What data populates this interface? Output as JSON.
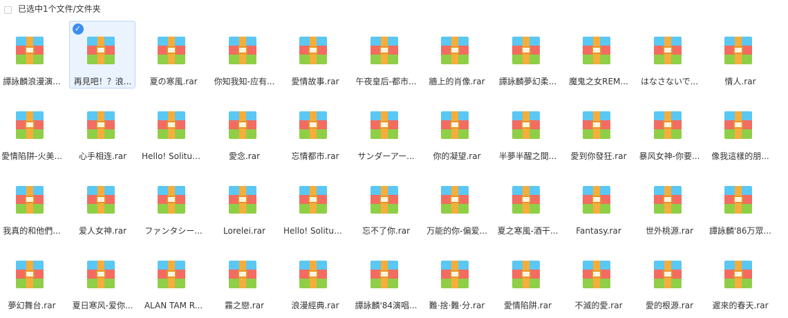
{
  "header": {
    "selection_text": "已选中1个文件/文件夹"
  },
  "colors": {
    "accent": "#3b8df2",
    "selected_bg": "#eaf3fe"
  },
  "files": [
    {
      "name": "譚詠麟浪漫演...",
      "icon": "archive-rar-icon",
      "selected": false
    },
    {
      "name": "再見吧！？浪...",
      "icon": "archive-rar-icon",
      "selected": true
    },
    {
      "name": "夏の寒風.rar",
      "icon": "archive-rar-icon",
      "selected": false
    },
    {
      "name": "你知我知-应有...",
      "icon": "archive-rar-icon",
      "selected": false
    },
    {
      "name": "愛情故事.rar",
      "icon": "archive-rar-icon",
      "selected": false
    },
    {
      "name": "午夜皇后-都市...",
      "icon": "archive-rar-icon",
      "selected": false
    },
    {
      "name": "牆上的肖像.rar",
      "icon": "archive-rar-icon",
      "selected": false
    },
    {
      "name": "譚詠麟夢幻柔...",
      "icon": "archive-rar-icon",
      "selected": false
    },
    {
      "name": "魔鬼之女REM...",
      "icon": "archive-rar-icon",
      "selected": false
    },
    {
      "name": "はなさないで...",
      "icon": "archive-rar-icon",
      "selected": false
    },
    {
      "name": "情人.rar",
      "icon": "archive-rar-icon",
      "selected": false
    },
    {
      "name": "愛情陷阱-火美...",
      "icon": "archive-rar-icon",
      "selected": false
    },
    {
      "name": "心手相连.rar",
      "icon": "archive-rar-icon",
      "selected": false
    },
    {
      "name": "Hello! Solitud...",
      "icon": "archive-rar-icon",
      "selected": false
    },
    {
      "name": "愛念.rar",
      "icon": "archive-rar-icon",
      "selected": false
    },
    {
      "name": "忘情都市.rar",
      "icon": "archive-rar-icon",
      "selected": false
    },
    {
      "name": "サンダーアー...",
      "icon": "archive-rar-icon",
      "selected": false
    },
    {
      "name": "你的凝望.rar",
      "icon": "archive-rar-icon",
      "selected": false
    },
    {
      "name": "半夢半醒之間...",
      "icon": "archive-rar-icon",
      "selected": false
    },
    {
      "name": "愛到你發狂.rar",
      "icon": "archive-rar-icon",
      "selected": false
    },
    {
      "name": "暴风女神-你要...",
      "icon": "archive-rar-icon",
      "selected": false
    },
    {
      "name": "像我這樣的朋...",
      "icon": "archive-rar-icon",
      "selected": false
    },
    {
      "name": "我真的和他們...",
      "icon": "archive-rar-icon",
      "selected": false
    },
    {
      "name": "爱人女神.rar",
      "icon": "archive-rar-icon",
      "selected": false
    },
    {
      "name": "ファンタシー...",
      "icon": "archive-rar-icon",
      "selected": false
    },
    {
      "name": "Lorelei.rar",
      "icon": "archive-rar-icon",
      "selected": false
    },
    {
      "name": "Hello! Solitud...",
      "icon": "archive-rar-icon",
      "selected": false
    },
    {
      "name": "忘不了你.rar",
      "icon": "archive-rar-icon",
      "selected": false
    },
    {
      "name": "万能的你-偏爱...",
      "icon": "archive-rar-icon",
      "selected": false
    },
    {
      "name": "夏之寒風-酒干...",
      "icon": "archive-rar-icon",
      "selected": false
    },
    {
      "name": "Fantasy.rar",
      "icon": "archive-rar-icon",
      "selected": false
    },
    {
      "name": "世外桃源.rar",
      "icon": "archive-rar-icon",
      "selected": false
    },
    {
      "name": "譚詠麟'86万眾...",
      "icon": "archive-rar-icon",
      "selected": false
    },
    {
      "name": "夢幻舞台.rar",
      "icon": "archive-rar-icon",
      "selected": false
    },
    {
      "name": "夏日寒风-爱你...",
      "icon": "archive-rar-icon",
      "selected": false
    },
    {
      "name": "ALAN TAM R...",
      "icon": "archive-rar-icon",
      "selected": false
    },
    {
      "name": "霧之戀.rar",
      "icon": "archive-rar-icon",
      "selected": false
    },
    {
      "name": "浪漫經典.rar",
      "icon": "archive-rar-icon",
      "selected": false
    },
    {
      "name": "譚詠麟'84演唱...",
      "icon": "archive-rar-icon",
      "selected": false
    },
    {
      "name": "難·捨·難·分.rar",
      "icon": "archive-rar-icon",
      "selected": false
    },
    {
      "name": "愛情陷阱.rar",
      "icon": "archive-rar-icon",
      "selected": false
    },
    {
      "name": "不滅的愛.rar",
      "icon": "archive-rar-icon",
      "selected": false
    },
    {
      "name": "愛的根源.rar",
      "icon": "archive-rar-icon",
      "selected": false
    },
    {
      "name": "遲來的春天.rar",
      "icon": "archive-rar-icon",
      "selected": false
    }
  ]
}
